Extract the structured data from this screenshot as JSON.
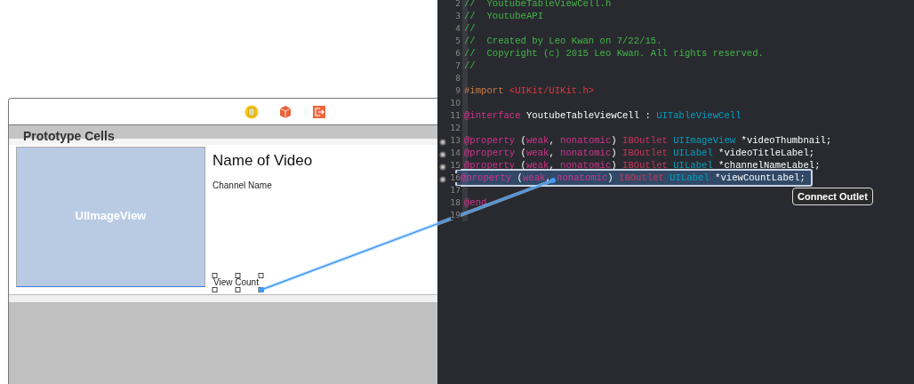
{
  "canvas": {
    "section_header": "Prototype Cells",
    "cell": {
      "image_placeholder": "UIImageView",
      "title": "Name of Video",
      "subtitle": "Channel Name",
      "count_label": "View Count"
    }
  },
  "editor": {
    "lines": [
      {
        "number": "2",
        "outlet": false,
        "highlighted": false,
        "tokens": [
          {
            "kind": "comment",
            "text": "//  YoutubeTableViewCell.h"
          }
        ]
      },
      {
        "number": "3",
        "outlet": false,
        "highlighted": false,
        "tokens": [
          {
            "kind": "comment",
            "text": "//  YoutubeAPI"
          }
        ]
      },
      {
        "number": "4",
        "outlet": false,
        "highlighted": false,
        "tokens": [
          {
            "kind": "comment",
            "text": "//"
          }
        ]
      },
      {
        "number": "5",
        "outlet": false,
        "highlighted": false,
        "tokens": [
          {
            "kind": "comment",
            "text": "//  Created by Leo Kwan on 7/22/15."
          }
        ]
      },
      {
        "number": "6",
        "outlet": false,
        "highlighted": false,
        "tokens": [
          {
            "kind": "comment",
            "text": "//  Copyright (c) 2015 Leo Kwan. All rights reserved."
          }
        ]
      },
      {
        "number": "7",
        "outlet": false,
        "highlighted": false,
        "tokens": [
          {
            "kind": "comment",
            "text": "//"
          }
        ]
      },
      {
        "number": "8",
        "outlet": false,
        "highlighted": false
      },
      {
        "number": "9",
        "outlet": false,
        "highlighted": false,
        "tokens": [
          {
            "kind": "preprocessor",
            "text": "#import"
          },
          {
            "kind": "string",
            "text": " <UIKit/UIKit.h>"
          }
        ]
      },
      {
        "number": "10",
        "outlet": false,
        "highlighted": false
      },
      {
        "number": "11",
        "outlet": false,
        "highlighted": false,
        "tokens": [
          {
            "kind": "keyword",
            "text": "@interface"
          },
          {
            "kind": "plain",
            "text": " YoutubeTableViewCell : "
          },
          {
            "kind": "type",
            "text": "UITableViewCell"
          }
        ]
      },
      {
        "number": "12",
        "outlet": false,
        "highlighted": false
      },
      {
        "number": "13",
        "outlet": true,
        "highlighted": false,
        "tokens": [
          {
            "kind": "keyword",
            "text": "@property"
          },
          {
            "kind": "plain",
            "text": " ("
          },
          {
            "kind": "keyword",
            "text": "weak"
          },
          {
            "kind": "plain",
            "text": ", "
          },
          {
            "kind": "keyword",
            "text": "nonatomic"
          },
          {
            "kind": "plain",
            "text": ") "
          },
          {
            "kind": "macro",
            "text": "IBOutlet"
          },
          {
            "kind": "type",
            "text": " UIImageView"
          },
          {
            "kind": "plain",
            "text": " *videoThumbnail;"
          }
        ]
      },
      {
        "number": "14",
        "outlet": true,
        "highlighted": false,
        "tokens": [
          {
            "kind": "keyword",
            "text": "@property"
          },
          {
            "kind": "plain",
            "text": " ("
          },
          {
            "kind": "keyword",
            "text": "weak"
          },
          {
            "kind": "plain",
            "text": ", "
          },
          {
            "kind": "keyword",
            "text": "nonatomic"
          },
          {
            "kind": "plain",
            "text": ") "
          },
          {
            "kind": "macro",
            "text": "IBOutlet"
          },
          {
            "kind": "type",
            "text": " UILabel"
          },
          {
            "kind": "plain",
            "text": " *videoTitleLabel;"
          }
        ]
      },
      {
        "number": "15",
        "outlet": true,
        "highlighted": false,
        "tokens": [
          {
            "kind": "keyword",
            "text": "@property"
          },
          {
            "kind": "plain",
            "text": " ("
          },
          {
            "kind": "keyword",
            "text": "weak"
          },
          {
            "kind": "plain",
            "text": ", "
          },
          {
            "kind": "keyword",
            "text": "nonatomic"
          },
          {
            "kind": "plain",
            "text": ") "
          },
          {
            "kind": "macro",
            "text": "IBOutlet"
          },
          {
            "kind": "type",
            "text": " UILabel"
          },
          {
            "kind": "plain",
            "text": " *channelNameLabel;"
          }
        ]
      },
      {
        "number": "16",
        "outlet": true,
        "highlighted": true,
        "tokens": [
          {
            "kind": "keyword",
            "text": "@property"
          },
          {
            "kind": "plain",
            "text": " ("
          },
          {
            "kind": "keyword",
            "text": "weak"
          },
          {
            "kind": "plain",
            "text": ", "
          },
          {
            "kind": "keyword",
            "text": "nonatomic"
          },
          {
            "kind": "plain",
            "text": ") "
          },
          {
            "kind": "macro",
            "text": "IBOutlet"
          },
          {
            "kind": "type",
            "text": " UILabel"
          },
          {
            "kind": "plain",
            "text": " *viewCountLabel;"
          }
        ]
      },
      {
        "number": "17",
        "outlet": false,
        "highlighted": false
      },
      {
        "number": "18",
        "outlet": false,
        "highlighted": false,
        "tokens": [
          {
            "kind": "keyword",
            "text": "@end"
          }
        ]
      },
      {
        "number": "19",
        "outlet": false,
        "highlighted": false
      }
    ]
  },
  "tooltip": "Connect Outlet"
}
